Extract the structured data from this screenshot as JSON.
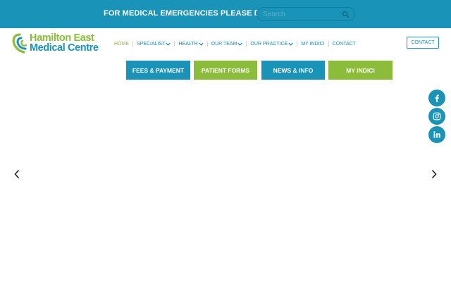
{
  "topbar": {
    "emergency_text": "FOR MEDICAL EMERGENCIES PLEASE DIAL 111",
    "search_placeholder": "Search",
    "bg_color": "#1a93b8"
  },
  "logo": {
    "line1": "Hamilton East",
    "line2": "Medical Centre"
  },
  "nav": {
    "items": [
      {
        "label": "HOME",
        "active": true,
        "dropdown": false
      },
      {
        "label": "SPECIALIST",
        "active": false,
        "dropdown": true
      },
      {
        "label": "HEALTH",
        "active": false,
        "dropdown": true
      },
      {
        "label": "OUR TEAM",
        "active": false,
        "dropdown": true
      },
      {
        "label": "OUR PRACTICE",
        "active": false,
        "dropdown": true
      },
      {
        "label": "MY INDICI",
        "active": false,
        "dropdown": false
      },
      {
        "label": "CONTACT",
        "active": false,
        "dropdown": false
      }
    ],
    "contact_button": "CONTACT"
  },
  "quick_links": [
    {
      "label": "FEES & PAYMENT",
      "color": "#1a93b8"
    },
    {
      "label": "PATIENT FORMS",
      "color": "#8bbd3a"
    },
    {
      "label": "NEWS & INFO",
      "color": "#1a93b8"
    },
    {
      "label": "MY INDICI",
      "color": "#8bbd3a"
    }
  ],
  "social": {
    "icons": [
      "facebook-icon",
      "instagram-icon",
      "linkedin-icon"
    ]
  },
  "slider": {
    "prev_icon": "chevron-left-icon",
    "next_icon": "chevron-right-icon"
  },
  "colors": {
    "brand_blue": "#1a93b8",
    "brand_green": "#8bbd3a"
  }
}
